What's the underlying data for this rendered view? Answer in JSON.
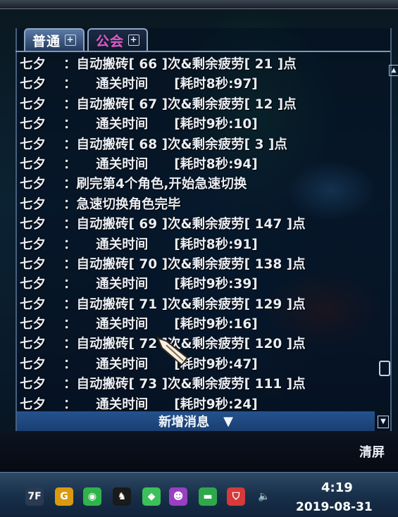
{
  "tabs": [
    {
      "label": "普通",
      "plus": "+"
    },
    {
      "label": "公会",
      "plus": "+"
    }
  ],
  "messages": [
    {
      "sender": "七夕",
      "sep": "：",
      "text": "自动搬砖[ 66 ]次&剩余疲劳[ 21 ]点"
    },
    {
      "sender": "七夕",
      "sep": "：",
      "text": "　　通关时间　　[耗时8秒:97]"
    },
    {
      "sender": "七夕",
      "sep": "：",
      "text": "自动搬砖[ 67 ]次&剩余疲劳[ 12 ]点"
    },
    {
      "sender": "七夕",
      "sep": "：",
      "text": "　　通关时间　　[耗时9秒:10]"
    },
    {
      "sender": "七夕",
      "sep": "：",
      "text": "自动搬砖[ 68 ]次&剩余疲劳[ 3 ]点"
    },
    {
      "sender": "七夕",
      "sep": "：",
      "text": "　　通关时间　　[耗时8秒:94]"
    },
    {
      "sender": "七夕",
      "sep": "：",
      "text": "刷完第4个角色,开始急速切换"
    },
    {
      "sender": "七夕",
      "sep": "：",
      "text": "急速切换角色完毕"
    },
    {
      "sender": "七夕",
      "sep": "：",
      "text": "自动搬砖[ 69 ]次&剩余疲劳[ 147 ]点"
    },
    {
      "sender": "七夕",
      "sep": "：",
      "text": "　　通关时间　　[耗时8秒:91]"
    },
    {
      "sender": "七夕",
      "sep": "：",
      "text": "自动搬砖[ 70 ]次&剩余疲劳[ 138 ]点"
    },
    {
      "sender": "七夕",
      "sep": "：",
      "text": "　　通关时间　　[耗时9秒:39]"
    },
    {
      "sender": "七夕",
      "sep": "：",
      "text": "自动搬砖[ 71 ]次&剩余疲劳[ 129 ]点"
    },
    {
      "sender": "七夕",
      "sep": "：",
      "text": "　　通关时间　　[耗时9秒:16]"
    },
    {
      "sender": "七夕",
      "sep": "：",
      "text": "自动搬砖[ 72 ]次&剩余疲劳[ 120 ]点"
    },
    {
      "sender": "七夕",
      "sep": "：",
      "text": "　　通关时间　　[耗时9秒:47]"
    },
    {
      "sender": "七夕",
      "sep": "：",
      "text": "自动搬砖[ 73 ]次&剩余疲劳[ 111 ]点"
    },
    {
      "sender": "七夕",
      "sep": "：",
      "text": "　　通关时间　　[耗时9秒:24]"
    }
  ],
  "new_messages_label": "新增消息",
  "new_messages_arrow": "▼",
  "scroll_up_arrow": "▲",
  "scroll_down_arrow": "▼",
  "clear_label": "清屏",
  "taskbar": {
    "time": "4:19",
    "date": "2019-08-31",
    "icons": [
      {
        "name": "app-7f-icon",
        "glyph": "7F",
        "color": "#2a3a52"
      },
      {
        "name": "app-g-icon",
        "glyph": "G",
        "color": "#d99a12"
      },
      {
        "name": "wechat-icon",
        "glyph": "◉",
        "color": "#2fb34a"
      },
      {
        "name": "qq-icon",
        "glyph": "♞",
        "color": "#1a1a1a"
      },
      {
        "name": "app-green-icon",
        "glyph": "◆",
        "color": "#3cc05a"
      },
      {
        "name": "app-purple-icon",
        "glyph": "☻",
        "color": "#9a3fc2"
      },
      {
        "name": "app-box-icon",
        "glyph": "▬",
        "color": "#2ea84a"
      },
      {
        "name": "app-shield-icon",
        "glyph": "⛉",
        "color": "#d63a3a"
      },
      {
        "name": "volume-icon",
        "glyph": "🔈",
        "color": "transparent"
      }
    ]
  }
}
